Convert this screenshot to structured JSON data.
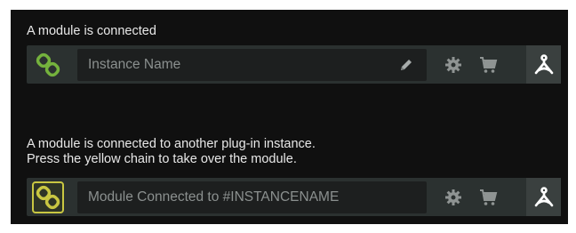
{
  "sections": [
    {
      "caption_lines": [
        "A module is connected"
      ],
      "field_text": "Instance Name",
      "chain_color": "#74b23d",
      "chain_state": "connected"
    },
    {
      "caption_lines": [
        "A module is connected to another plug-in instance.",
        "Press the yellow chain to take over the module."
      ],
      "field_text": "Module Connected to #INSTANCENAME",
      "chain_color": "#c9c742",
      "chain_state": "taken-by-other"
    }
  ],
  "icons": {
    "chain": "link-chain-icon",
    "edit": "pencil-icon",
    "settings": "gear-icon",
    "store": "shopping-cart-icon",
    "brand": "brand-logo-icon"
  },
  "colors": {
    "panel_bg": "#101010",
    "bar_bg": "#2b3130",
    "field_bg": "#1d1f1f",
    "text": "#e8e8e8",
    "icon_grey": "#a7acab"
  }
}
